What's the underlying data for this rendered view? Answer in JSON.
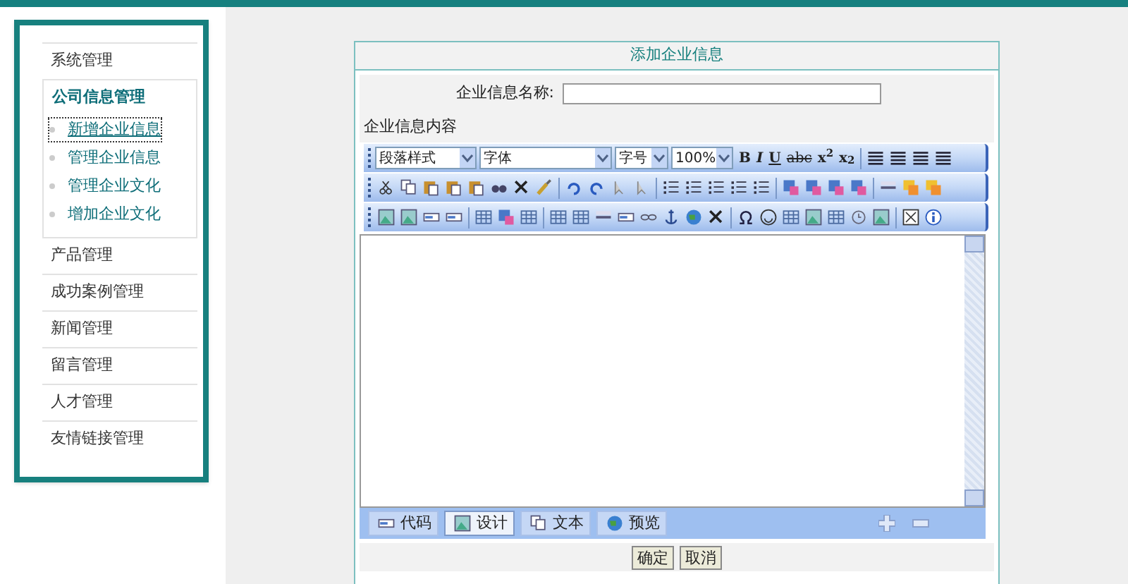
{
  "sidebar": {
    "sections": [
      {
        "title": "系统管理",
        "expanded": false
      },
      {
        "title": "公司信息管理",
        "expanded": true,
        "children": [
          {
            "label": "新增企业信息",
            "selected": true
          },
          {
            "label": "管理企业信息",
            "selected": false
          },
          {
            "label": "管理企业文化",
            "selected": false
          },
          {
            "label": "增加企业文化",
            "selected": false
          }
        ]
      },
      {
        "title": "产品管理",
        "expanded": false
      },
      {
        "title": "成功案例管理",
        "expanded": false
      },
      {
        "title": "新闻管理",
        "expanded": false
      },
      {
        "title": "留言管理",
        "expanded": false
      },
      {
        "title": "人才管理",
        "expanded": false
      },
      {
        "title": "友情链接管理",
        "expanded": false
      }
    ]
  },
  "form": {
    "title": "添加企业信息",
    "name_label": "企业信息名称:",
    "content_label": "企业信息内容",
    "editor": {
      "dropdowns": [
        "段落样式",
        "字体",
        "字号",
        "100%"
      ],
      "format_buttons": [
        "B",
        "I",
        "U",
        "abc",
        "x$^{2}$",
        "x$_{2}$"
      ],
      "modes": [
        {
          "label": "代码",
          "selected": false
        },
        {
          "label": "设计",
          "selected": true
        },
        {
          "label": "文本",
          "selected": false
        },
        {
          "label": "预览",
          "selected": false
        }
      ]
    },
    "buttons": [
      "确定",
      "取消"
    ]
  }
}
